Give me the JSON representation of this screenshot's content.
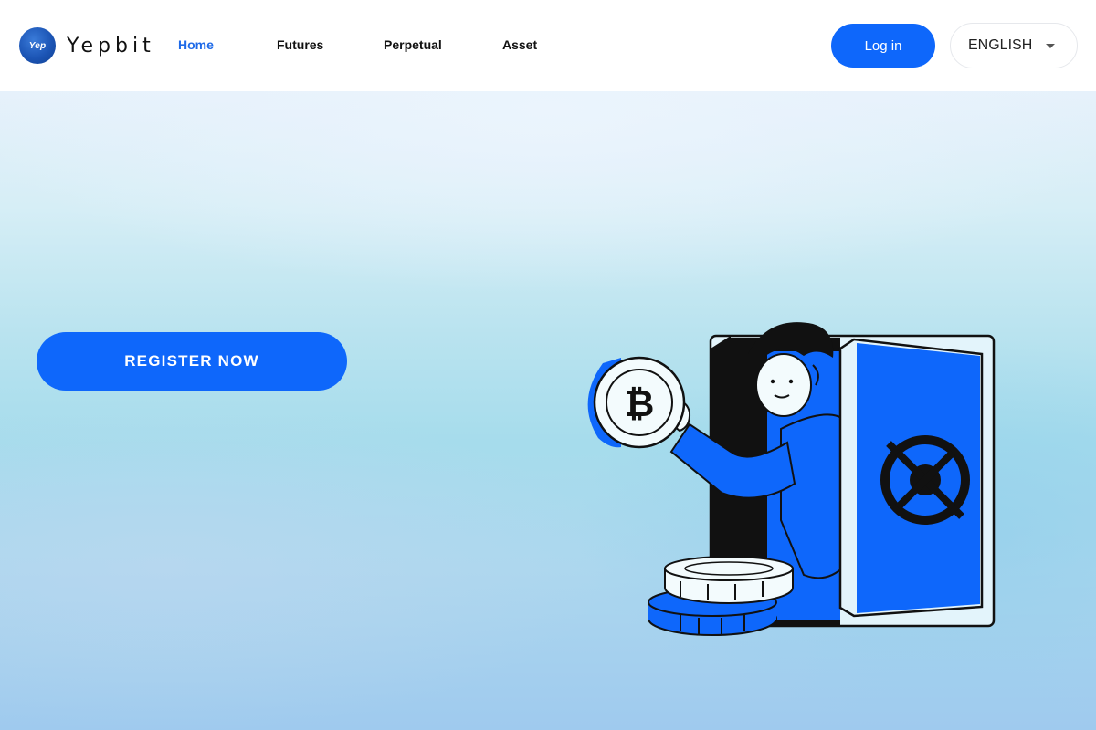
{
  "brand": {
    "badge_text": "Yep",
    "name": "Yepbit"
  },
  "nav": {
    "items": [
      {
        "label": "Home",
        "active": true
      },
      {
        "label": "Futures",
        "active": false
      },
      {
        "label": "Perpetual",
        "active": false
      },
      {
        "label": "Asset",
        "active": false
      }
    ]
  },
  "header": {
    "login_label": "Log in",
    "language": "ENGLISH"
  },
  "hero": {
    "register_label": "REGISTER NOW",
    "illustration": "person-with-bitcoin-and-safe"
  },
  "colors": {
    "accent": "#0e67fb",
    "nav_active": "#1e6ae8",
    "header_bg": "#ffffff",
    "hero_gradient_top": "#e6f1fb",
    "hero_gradient_bottom": "#9fcaee"
  }
}
